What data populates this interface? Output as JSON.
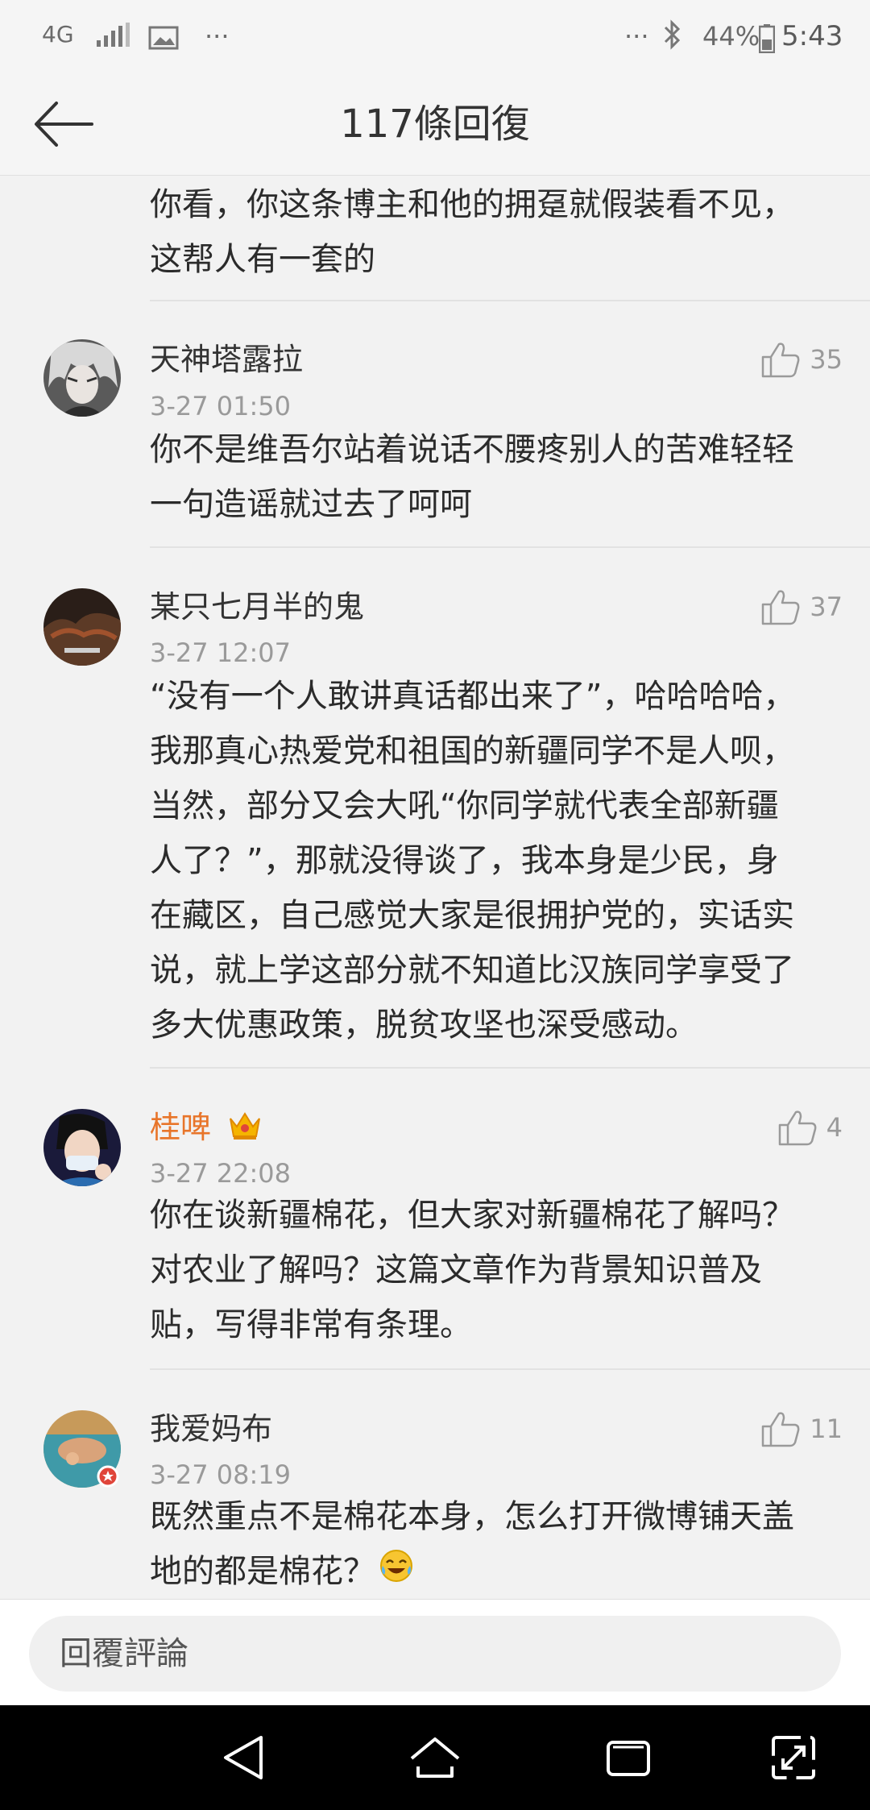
{
  "status_bar": {
    "network": "4G",
    "dots_left": "···",
    "dots_right": "···",
    "battery_percent": "44%",
    "time": "5:43"
  },
  "header": {
    "title": "117條回復"
  },
  "comments": [
    {
      "text_lines": [
        "你看，你这条博主和他的拥趸就假装看不见，",
        "这帮人有一套的"
      ]
    },
    {
      "username": "天神塔露拉",
      "timestamp": "3-27 01:50",
      "likes": "35",
      "text_lines": [
        "你不是维吾尔站着说话不腰疼别人的苦难轻轻",
        "一句造谣就过去了呵呵"
      ]
    },
    {
      "username": "某只七月半的鬼",
      "timestamp": "3-27 12:07",
      "likes": "37",
      "text_lines": [
        "“没有一个人敢讲真话都出来了”，哈哈哈哈，",
        "我那真心热爱党和祖国的新疆同学不是人呗，",
        "当然，部分又会大吼“你同学就代表全部新疆",
        "人了？”，那就没得谈了，我本身是少民，身",
        "在藏区，自己感觉大家是很拥护党的，实话实",
        "说，就上学这部分就不知道比汉族同学享受了",
        "多大优惠政策，脱贫攻坚也深受感动。"
      ]
    },
    {
      "username": "桂啤",
      "timestamp": "3-27 22:08",
      "likes": "4",
      "text_lines": [
        "你在谈新疆棉花，但大家对新疆棉花了解吗？",
        "对农业了解吗？这篇文章作为背景知识普及",
        "贴，写得非常有条理。"
      ]
    },
    {
      "username": "我爱妈布",
      "timestamp": "3-27 08:19",
      "likes": "11",
      "text_lines": [
        "既然重点不是棉花本身，怎么打开微博铺天盖",
        "地的都是棉花？"
      ]
    }
  ],
  "reply_bar": {
    "placeholder": "回覆評論"
  },
  "colors": {
    "vip_name": "#e8752a",
    "background": "#f2f2f2",
    "nav_bar": "#000000"
  }
}
